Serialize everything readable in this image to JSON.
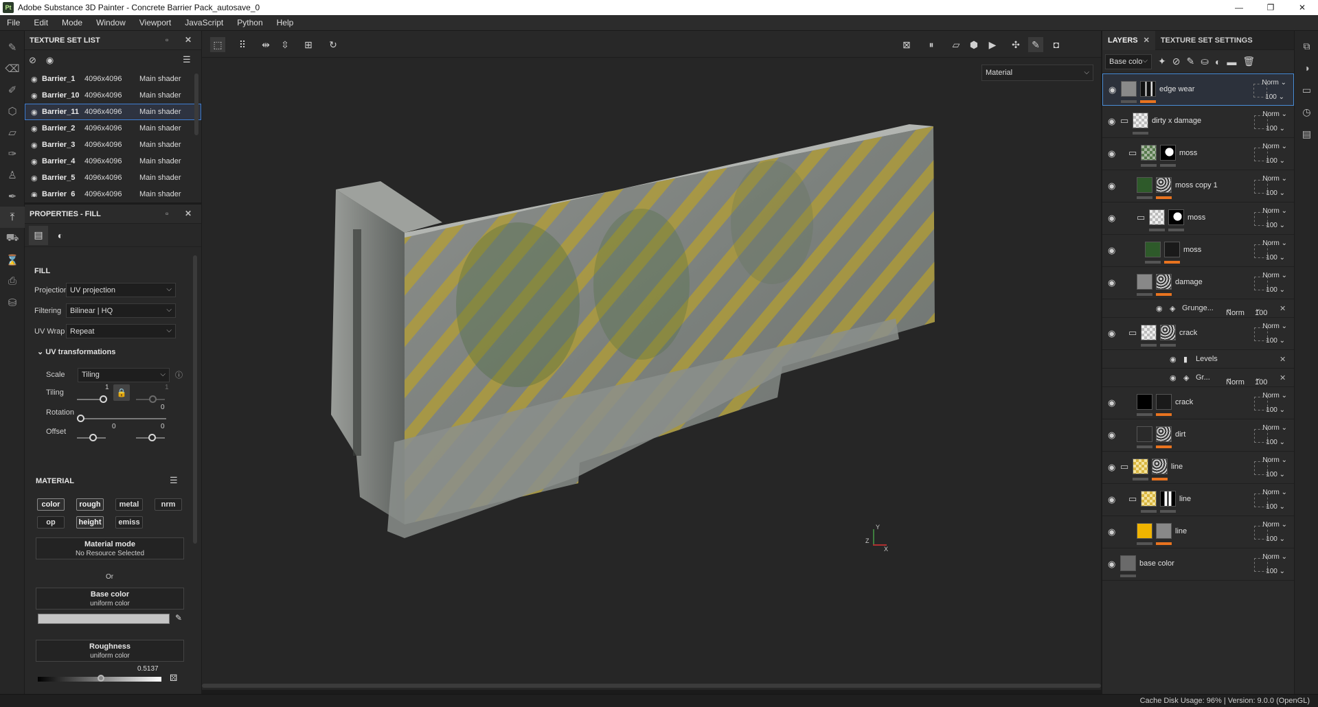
{
  "window": {
    "title": "Adobe Substance 3D Painter - Concrete Barrier Pack_autosave_0",
    "app_icon": "Pt",
    "controls": [
      "—",
      "❐",
      "✕"
    ]
  },
  "menu": [
    "File",
    "Edit",
    "Mode",
    "Window",
    "Viewport",
    "JavaScript",
    "Python",
    "Help"
  ],
  "texture_set_list": {
    "title": "TEXTURE SET LIST",
    "rows": [
      {
        "name": "Barrier_1",
        "res": "4096x4096",
        "shader": "Main shader"
      },
      {
        "name": "Barrier_10",
        "res": "4096x4096",
        "shader": "Main shader"
      },
      {
        "name": "Barrier_11",
        "res": "4096x4096",
        "shader": "Main shader",
        "selected": true
      },
      {
        "name": "Barrier_2",
        "res": "4096x4096",
        "shader": "Main shader"
      },
      {
        "name": "Barrier_3",
        "res": "4096x4096",
        "shader": "Main shader"
      },
      {
        "name": "Barrier_4",
        "res": "4096x4096",
        "shader": "Main shader"
      },
      {
        "name": "Barrier_5",
        "res": "4096x4096",
        "shader": "Main shader"
      },
      {
        "name": "Barrier_6",
        "res": "4096x4096",
        "shader": "Main shader"
      }
    ]
  },
  "properties": {
    "title": "PROPERTIES - FILL",
    "fill_label": "FILL",
    "projection": {
      "label": "Projection",
      "value": "UV projection"
    },
    "filtering": {
      "label": "Filtering",
      "value": "Bilinear | HQ"
    },
    "uv_wrap": {
      "label": "UV Wrap",
      "value": "Repeat"
    },
    "uv_transformations": "UV transformations",
    "scale": {
      "label": "Scale",
      "value": "Tiling"
    },
    "tiling": {
      "label": "Tiling",
      "value1": "1",
      "value2": "1"
    },
    "rotation": {
      "label": "Rotation",
      "value": "0"
    },
    "offset": {
      "label": "Offset",
      "value1": "0",
      "value2": "0"
    },
    "material_label": "MATERIAL",
    "channels": [
      {
        "label": "color",
        "on": true
      },
      {
        "label": "rough",
        "on": true
      },
      {
        "label": "metal",
        "on": false
      },
      {
        "label": "nrm",
        "on": false
      },
      {
        "label": "op",
        "on": false
      },
      {
        "label": "height",
        "on": true
      },
      {
        "label": "emiss",
        "on": false
      }
    ],
    "material_mode": {
      "title": "Material mode",
      "sub": "No Resource Selected"
    },
    "or_label": "Or",
    "base_color": {
      "title": "Base color",
      "sub": "uniform color",
      "color": "#c4c4c4"
    },
    "roughness": {
      "title": "Roughness",
      "sub": "uniform color",
      "value": "0.5137",
      "fraction": 0.5137
    }
  },
  "viewport": {
    "material_dropdown": "Material",
    "axis_labels": [
      "Y",
      "Z",
      "X"
    ]
  },
  "layers_panel": {
    "tabs": [
      "LAYERS",
      "TEXTURE SET SETTINGS"
    ],
    "channel_select": "Base colo",
    "layers": [
      {
        "name": "edge wear",
        "blend": "Norm",
        "opacity": "100",
        "selected": true
      },
      {
        "name": "dirty x damage",
        "blend": "Norm",
        "opacity": "100"
      },
      {
        "name": "moss",
        "blend": "Norm",
        "opacity": "100"
      },
      {
        "name": "moss copy 1",
        "blend": "Norm",
        "opacity": "100"
      },
      {
        "name": "moss",
        "blend": "Norm",
        "opacity": "100"
      },
      {
        "name": "moss",
        "blend": "Norm",
        "opacity": "100"
      },
      {
        "name": "damage",
        "blend": "Norm",
        "opacity": "100"
      },
      {
        "name": "crack",
        "blend": "Norm",
        "opacity": "100"
      },
      {
        "name": "crack",
        "blend": "Norm",
        "opacity": "100"
      },
      {
        "name": "dirt",
        "blend": "Norm",
        "opacity": "100"
      },
      {
        "name": "line",
        "blend": "Norm",
        "opacity": "100"
      },
      {
        "name": "line",
        "blend": "Norm",
        "opacity": "100"
      },
      {
        "name": "line",
        "blend": "Norm",
        "opacity": "100"
      },
      {
        "name": "base color",
        "blend": "Norm",
        "opacity": "100"
      }
    ],
    "effects": {
      "grunge1": {
        "name": "Grunge...",
        "blend": "Norm",
        "opacity": "100"
      },
      "levels": {
        "name": "Levels"
      },
      "grunge2": {
        "name": "Gr...",
        "blend": "Norm",
        "opacity": "100"
      }
    }
  },
  "status": "Cache Disk Usage:    96% | Version: 9.0.0 (OpenGL)"
}
